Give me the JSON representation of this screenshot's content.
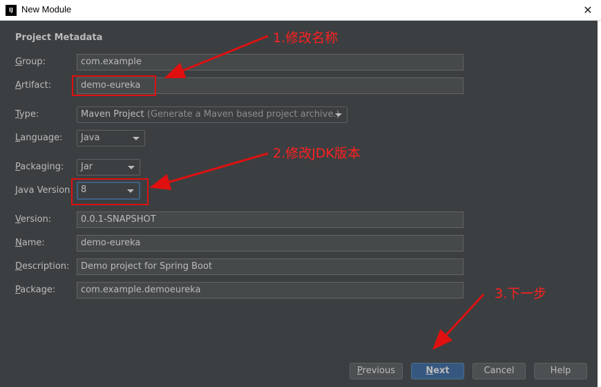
{
  "window": {
    "title": "New Module",
    "app_icon_text": "IJ",
    "close_glyph": "✕"
  },
  "section_title": "Project Metadata",
  "form": {
    "group": {
      "label": "Group:",
      "mnemonic": "G",
      "rest": "roup:",
      "value": "com.example"
    },
    "artifact": {
      "label": "Artifact:",
      "mnemonic": "A",
      "rest": "rtifact:",
      "value": "demo-eureka"
    },
    "type": {
      "label": "Type:",
      "mnemonic": "T",
      "rest": "ype:",
      "value": "Maven Project",
      "hint": "(Generate a Maven based project archive.)"
    },
    "language": {
      "label": "Language:",
      "mnemonic": "L",
      "rest": "anguage:",
      "value": "Java"
    },
    "packaging": {
      "label": "Packaging:",
      "mnemonic": "P",
      "rest": "ackaging:",
      "value": "Jar"
    },
    "java_version": {
      "label": "Java Version:",
      "mnemonic": "J",
      "rest": "ava Version:",
      "value": "8"
    },
    "version": {
      "label": "Version:",
      "mnemonic": "V",
      "rest": "ersion:",
      "value": "0.0.1-SNAPSHOT"
    },
    "name": {
      "label": "Name:",
      "mnemonic": "N",
      "rest": "ame:",
      "value": "demo-eureka"
    },
    "description": {
      "label": "Description:",
      "mnemonic": "D",
      "rest": "escription:",
      "value": "Demo project for Spring Boot"
    },
    "package": {
      "label": "Package:",
      "mnemonic": "P",
      "rest": "ackage:",
      "value": "com.example.demoeureka"
    }
  },
  "annotations": {
    "a1": "1.修改名称",
    "a2": "2.修改JDK版本",
    "a3": "3.下一步",
    "color": "#ff2020"
  },
  "buttons": {
    "previous": {
      "mnemonic": "P",
      "rest": "revious"
    },
    "next": {
      "mnemonic": "N",
      "rest": "ext"
    },
    "cancel": "Cancel",
    "help": "Help"
  },
  "colors": {
    "background": "#3c3f41",
    "field_bg": "#45494a",
    "primary_button": "#365880",
    "annotation": "#e01010"
  }
}
